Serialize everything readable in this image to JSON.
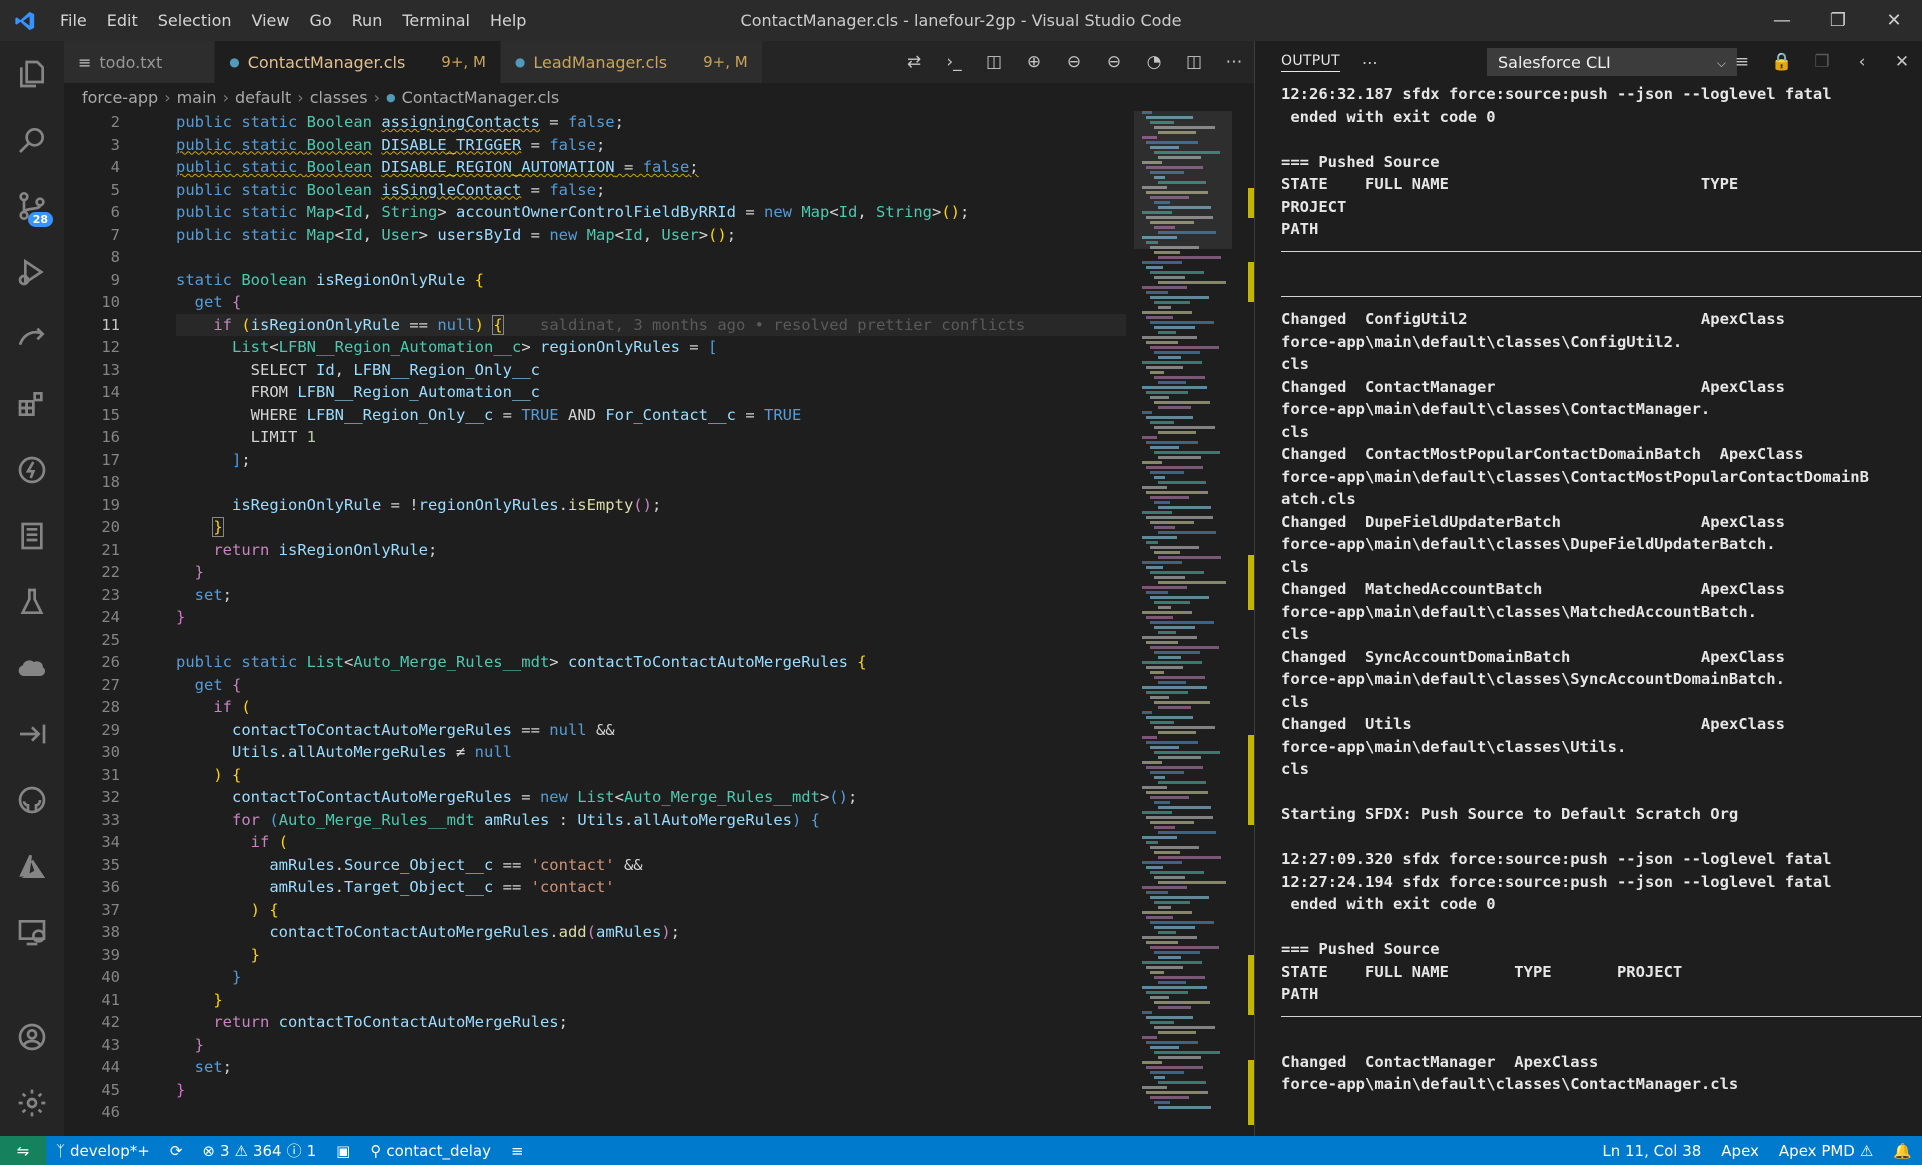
{
  "titlebar": {
    "menu": [
      "File",
      "Edit",
      "Selection",
      "View",
      "Go",
      "Run",
      "Terminal",
      "Help"
    ],
    "title": "ContactManager.cls - lanefour-2gp - Visual Studio Code"
  },
  "activitybar": {
    "items": [
      "explorer-icon",
      "search-icon",
      "source-control-icon",
      "run-debug-icon",
      "remote-icon",
      "extensions-icon",
      "lightning-icon",
      "notebook-icon",
      "testing-icon",
      "salesforce-cloud-icon",
      "arrow-right-icon",
      "github-icon",
      "azure-icon",
      "remote-explorer-icon"
    ],
    "scm_badge": "28",
    "bottom": [
      "account-icon",
      "gear-icon"
    ]
  },
  "tabs": [
    {
      "label": "todo.txt",
      "status": "",
      "active": false
    },
    {
      "label": "ContactManager.cls",
      "status": "9+, M",
      "active": true
    },
    {
      "label": "LeadManager.cls",
      "status": "9+, M",
      "active": false
    }
  ],
  "breadcrumb": [
    "force-app",
    "main",
    "default",
    "classes",
    "ContactManager.cls"
  ],
  "editor": {
    "line_numbers": [
      "2",
      "3",
      "4",
      "5",
      "6",
      "7",
      "8",
      "9",
      "10",
      "11",
      "12",
      "13",
      "14",
      "15",
      "16",
      "17",
      "18",
      "19",
      "20",
      "21",
      "22",
      "23",
      "24",
      "25",
      "26",
      "27",
      "28",
      "29",
      "30",
      "31",
      "32",
      "33",
      "34",
      "35",
      "36",
      "37",
      "38",
      "39",
      "40",
      "41",
      "42",
      "43",
      "44",
      "45",
      "46"
    ],
    "current_line": "11",
    "blame": "saldinat, 3 months ago • resolved prettier conflicts"
  },
  "panel": {
    "title": "OUTPUT",
    "channel": "Salesforce CLI",
    "lines": [
      "12:26:32.187 sfdx force:source:push --json --loglevel fatal",
      " ended with exit code 0",
      "",
      "=== Pushed Source",
      "STATE    FULL NAME                           TYPE",
      "PROJECT",
      "PATH",
      "---",
      "",
      "---",
      "Changed  ConfigUtil2                         ApexClass",
      "force-app\\main\\default\\classes\\ConfigUtil2.",
      "cls",
      "Changed  ContactManager                      ApexClass",
      "force-app\\main\\default\\classes\\ContactManager.",
      "cls",
      "Changed  ContactMostPopularContactDomainBatch  ApexClass",
      "force-app\\main\\default\\classes\\ContactMostPopularContactDomainB",
      "atch.cls",
      "Changed  DupeFieldUpdaterBatch               ApexClass",
      "force-app\\main\\default\\classes\\DupeFieldUpdaterBatch.",
      "cls",
      "Changed  MatchedAccountBatch                 ApexClass",
      "force-app\\main\\default\\classes\\MatchedAccountBatch.",
      "cls",
      "Changed  SyncAccountDomainBatch              ApexClass",
      "force-app\\main\\default\\classes\\SyncAccountDomainBatch.",
      "cls",
      "Changed  Utils                               ApexClass",
      "force-app\\main\\default\\classes\\Utils.",
      "cls",
      "",
      "Starting SFDX: Push Source to Default Scratch Org",
      "",
      "12:27:09.320 sfdx force:source:push --json --loglevel fatal",
      "12:27:24.194 sfdx force:source:push --json --loglevel fatal",
      " ended with exit code 0",
      "",
      "=== Pushed Source",
      "STATE    FULL NAME       TYPE       PROJECT",
      "PATH",
      "---",
      "",
      "Changed  ContactManager  ApexClass",
      "force-app\\main\\default\\classes\\ContactManager.cls"
    ]
  },
  "statusbar": {
    "branch": "develop*+",
    "errors": "3",
    "warnings": "364",
    "infos": "1",
    "org": "contact_delay",
    "position": "Ln 11, Col 38",
    "language": "Apex",
    "linter": "Apex PMD"
  },
  "colors": {
    "statusbar": "#007acc",
    "remote": "#16825d",
    "accent": "#3794ff",
    "modified_tab": "#e2c08d"
  }
}
